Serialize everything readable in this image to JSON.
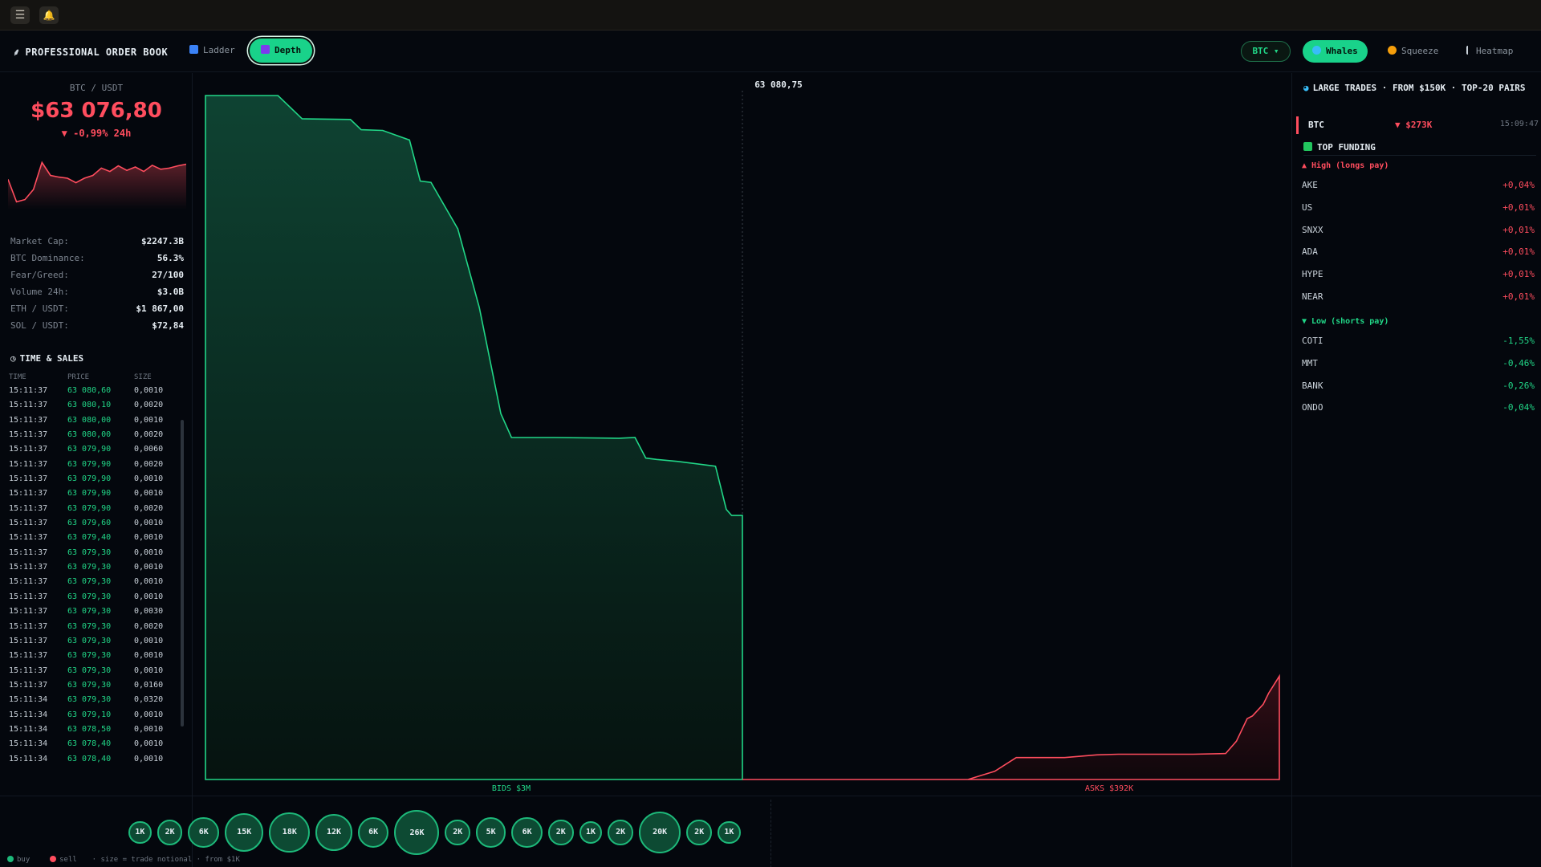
{
  "window": {
    "menu_icon": "☰",
    "bell_icon": "🔔"
  },
  "header": {
    "title": "PROFESSIONAL ORDER BOOK",
    "tabs": [
      {
        "label": "Ladder"
      },
      {
        "label": "Depth"
      }
    ],
    "active_tab": "Depth",
    "pair_select": "BTC ▾",
    "modes": [
      {
        "label": "Whales"
      },
      {
        "label": "Squeeze"
      },
      {
        "label": "Heatmap"
      }
    ],
    "active_mode": "Whales"
  },
  "ticker": {
    "pair": "BTC / USDT",
    "price": "$63 076,80",
    "change": "▼ -0,99% 24h",
    "sparkline": [
      0.48,
      0.08,
      0.12,
      0.3,
      0.78,
      0.55,
      0.52,
      0.5,
      0.42,
      0.5,
      0.55,
      0.68,
      0.62,
      0.72,
      0.64,
      0.7,
      0.62,
      0.73,
      0.66,
      0.68,
      0.72,
      0.75
    ]
  },
  "stats": [
    {
      "label": "Market Cap:",
      "value": "$2247.3B"
    },
    {
      "label": "BTC Dominance:",
      "value": "56.3%"
    },
    {
      "label": "Fear/Greed:",
      "value": "27/100"
    },
    {
      "label": "Volume 24h:",
      "value": "$3.0B"
    },
    {
      "label": "ETH / USDT:",
      "value": "$1 867,00"
    },
    {
      "label": "SOL / USDT:",
      "value": "$72,84"
    }
  ],
  "time_sales": {
    "title": "TIME & SALES",
    "headers": {
      "time": "TIME",
      "price": "PRICE",
      "size": "SIZE"
    },
    "rows": [
      {
        "time": "15:11:37",
        "price": "63 080,60",
        "size": "0,0010"
      },
      {
        "time": "15:11:37",
        "price": "63 080,10",
        "size": "0,0020"
      },
      {
        "time": "15:11:37",
        "price": "63 080,00",
        "size": "0,0010"
      },
      {
        "time": "15:11:37",
        "price": "63 080,00",
        "size": "0,0020"
      },
      {
        "time": "15:11:37",
        "price": "63 079,90",
        "size": "0,0060"
      },
      {
        "time": "15:11:37",
        "price": "63 079,90",
        "size": "0,0020"
      },
      {
        "time": "15:11:37",
        "price": "63 079,90",
        "size": "0,0010"
      },
      {
        "time": "15:11:37",
        "price": "63 079,90",
        "size": "0,0010"
      },
      {
        "time": "15:11:37",
        "price": "63 079,90",
        "size": "0,0020"
      },
      {
        "time": "15:11:37",
        "price": "63 079,60",
        "size": "0,0010"
      },
      {
        "time": "15:11:37",
        "price": "63 079,40",
        "size": "0,0010"
      },
      {
        "time": "15:11:37",
        "price": "63 079,30",
        "size": "0,0010"
      },
      {
        "time": "15:11:37",
        "price": "63 079,30",
        "size": "0,0010"
      },
      {
        "time": "15:11:37",
        "price": "63 079,30",
        "size": "0,0010"
      },
      {
        "time": "15:11:37",
        "price": "63 079,30",
        "size": "0,0010"
      },
      {
        "time": "15:11:37",
        "price": "63 079,30",
        "size": "0,0030"
      },
      {
        "time": "15:11:37",
        "price": "63 079,30",
        "size": "0,0020"
      },
      {
        "time": "15:11:37",
        "price": "63 079,30",
        "size": "0,0010"
      },
      {
        "time": "15:11:37",
        "price": "63 079,30",
        "size": "0,0010"
      },
      {
        "time": "15:11:37",
        "price": "63 079,30",
        "size": "0,0010"
      },
      {
        "time": "15:11:37",
        "price": "63 079,30",
        "size": "0,0160"
      },
      {
        "time": "15:11:34",
        "price": "63 079,30",
        "size": "0,0320"
      },
      {
        "time": "15:11:34",
        "price": "63 079,10",
        "size": "0,0010"
      },
      {
        "time": "15:11:34",
        "price": "63 078,50",
        "size": "0,0010"
      },
      {
        "time": "15:11:34",
        "price": "63 078,40",
        "size": "0,0010"
      },
      {
        "time": "15:11:34",
        "price": "63 078,40",
        "size": "0,0010"
      }
    ]
  },
  "depth": {
    "mid_price": "63 080,75",
    "bids_label": "BIDS $3M",
    "asks_label": "ASKS $392K",
    "bids_curve": [
      [
        0,
        1.0
      ],
      [
        0.135,
        1.0
      ],
      [
        0.18,
        0.966
      ],
      [
        0.27,
        0.965
      ],
      [
        0.29,
        0.95
      ],
      [
        0.33,
        0.949
      ],
      [
        0.38,
        0.935
      ],
      [
        0.4,
        0.875
      ],
      [
        0.42,
        0.873
      ],
      [
        0.47,
        0.805
      ],
      [
        0.51,
        0.69
      ],
      [
        0.55,
        0.535
      ],
      [
        0.57,
        0.5
      ],
      [
        0.65,
        0.5
      ],
      [
        0.77,
        0.499
      ],
      [
        0.8,
        0.5
      ],
      [
        0.82,
        0.47
      ],
      [
        0.84,
        0.468
      ],
      [
        0.88,
        0.465
      ],
      [
        0.95,
        0.458
      ],
      [
        0.97,
        0.395
      ],
      [
        0.98,
        0.386
      ],
      [
        1.0,
        0.386
      ]
    ],
    "asks_curve": [
      [
        0,
        0.0
      ],
      [
        0.42,
        0.0
      ],
      [
        0.47,
        0.012
      ],
      [
        0.51,
        0.032
      ],
      [
        0.6,
        0.032
      ],
      [
        0.66,
        0.036
      ],
      [
        0.7,
        0.037
      ],
      [
        0.84,
        0.037
      ],
      [
        0.9,
        0.038
      ],
      [
        0.92,
        0.056
      ],
      [
        0.94,
        0.089
      ],
      [
        0.95,
        0.093
      ],
      [
        0.97,
        0.11
      ],
      [
        0.98,
        0.126
      ],
      [
        1.0,
        0.151
      ]
    ]
  },
  "large_trades": {
    "title": "LARGE TRADES · FROM $150K · TOP-20 PAIRS",
    "items": [
      {
        "symbol": "BTC",
        "amount": "▼ $273K",
        "time": "15:09:47"
      }
    ]
  },
  "top_funding": {
    "title": "TOP FUNDING",
    "high_title": "▲ High (longs pay)",
    "high": [
      {
        "symbol": "AKE",
        "rate": "+0,04%"
      },
      {
        "symbol": "US",
        "rate": "+0,01%"
      },
      {
        "symbol": "SNXX",
        "rate": "+0,01%"
      },
      {
        "symbol": "ADA",
        "rate": "+0,01%"
      },
      {
        "symbol": "HYPE",
        "rate": "+0,01%"
      },
      {
        "symbol": "NEAR",
        "rate": "+0,01%"
      }
    ],
    "low_title": "▼ Low (shorts pay)",
    "low": [
      {
        "symbol": "COTI",
        "rate": "-1,55%"
      },
      {
        "symbol": "MMT",
        "rate": "-0,46%"
      },
      {
        "symbol": "BANK",
        "rate": "-0,26%"
      },
      {
        "symbol": "ONDO",
        "rate": "-0,04%"
      }
    ]
  },
  "bubbles": {
    "items": [
      {
        "label": "1K",
        "size": 1
      },
      {
        "label": "2K",
        "size": 2
      },
      {
        "label": "6K",
        "size": 6
      },
      {
        "label": "15K",
        "size": 15
      },
      {
        "label": "18K",
        "size": 18
      },
      {
        "label": "12K",
        "size": 12
      },
      {
        "label": "6K",
        "size": 6
      },
      {
        "label": "26K",
        "size": 26
      },
      {
        "label": "2K",
        "size": 2
      },
      {
        "label": "5K",
        "size": 5
      },
      {
        "label": "6K",
        "size": 6
      },
      {
        "label": "2K",
        "size": 2
      },
      {
        "label": "1K",
        "size": 1
      },
      {
        "label": "2K",
        "size": 2
      },
      {
        "label": "20K",
        "size": 20
      },
      {
        "label": "2K",
        "size": 2
      },
      {
        "label": "1K",
        "size": 1
      }
    ],
    "legend": {
      "buy": "buy",
      "sell": "sell",
      "note": "·  size = trade notional  ·  from $1K"
    }
  },
  "colors": {
    "green": "#21d687",
    "red": "#ff4d5e",
    "bg": "#04070d"
  }
}
